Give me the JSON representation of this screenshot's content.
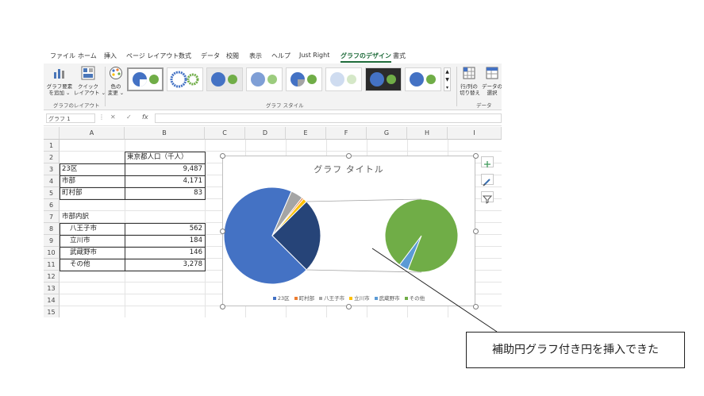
{
  "ribbon_tabs": [
    "ファイル",
    "ホーム",
    "挿入",
    "ページ レイアウト",
    "数式",
    "データ",
    "校閲",
    "表示",
    "ヘルプ",
    "Just Right",
    "グラフのデザイン",
    "書式"
  ],
  "ribbon": {
    "add_element_label": "グラフ要素\nを追加 ⌄",
    "quick_layout_label": "クイック\nレイアウト ⌄",
    "change_color_label": "色の\n変更 ⌄",
    "layout_group_label": "グラフのレイアウト",
    "styles_group_label": "グラフ スタイル",
    "switch_label": "行/列の\n切り替え",
    "select_data_label": "データの\n選択",
    "data_group_label": "データ"
  },
  "formula_bar": {
    "name_box": "グラフ 1",
    "fx": "fx"
  },
  "columns": [
    "A",
    "B",
    "C",
    "D",
    "E",
    "F",
    "G",
    "H",
    "I"
  ],
  "rows": [
    "1",
    "2",
    "3",
    "4",
    "5",
    "6",
    "7",
    "8",
    "9",
    "10",
    "11",
    "12",
    "13",
    "14",
    "15"
  ],
  "cells": {
    "b2": "東京都人口（千人）",
    "a3": "23区",
    "b3": "9,487",
    "a4": "市部",
    "b4": "4,171",
    "a5": "町村部",
    "b5": "83",
    "a7": "市部内訳",
    "a8": "八王子市",
    "b8": "562",
    "a9": "立川市",
    "b9": "184",
    "a10": "武蔵野市",
    "b10": "146",
    "a11": "その他",
    "b11": "3,278"
  },
  "chart_data": {
    "type": "pie",
    "subtype": "pie-of-pie",
    "title": "グラフ タイトル",
    "categories": [
      "23区",
      "町村部",
      "八王子市",
      "立川市",
      "武蔵野市",
      "その他"
    ],
    "values": [
      9487,
      83,
      562,
      184,
      146,
      3278
    ],
    "colors": [
      "#4472c4",
      "#ed7d31",
      "#a5a5a5",
      "#ffc000",
      "#5b9bd5",
      "#70ad47"
    ],
    "main_pie": {
      "slices": [
        "23区",
        "町村部",
        "八王子市",
        "立川市",
        "その他(補助)"
      ]
    },
    "secondary_pie": {
      "slices": [
        "その他",
        "武蔵野市"
      ]
    },
    "legend": {
      "position": "bottom",
      "labels": [
        "23区",
        "町村部",
        "八王子市",
        "立川市",
        "武蔵野市",
        "その他"
      ]
    }
  },
  "callout": {
    "text": "補助円グラフ付き円を挿入できた"
  }
}
